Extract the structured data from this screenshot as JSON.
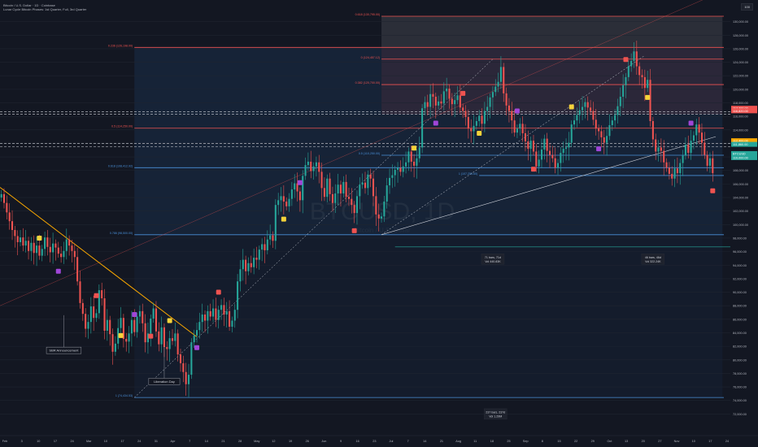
{
  "header": {
    "title": "Bitcoin / U.S. Dollar · 1D · Coinbase",
    "subtitle": "Lunar Cycle Bitcoin Phases: 1st Quarter, Full, 3rd Quarter",
    "scale_button": "100"
  },
  "watermark": {
    "symbol": "BTCUSD, 1D",
    "name": "Bitcoin / U.S. Dollar"
  },
  "colors": {
    "background": "#131722",
    "up": "#26a69a",
    "down": "#ef5350",
    "fib": "#4a90d9",
    "trendline": "#f7a600",
    "badge_yellow": "#f5d33a",
    "badge_purple": "#a046d8",
    "badge_red": "#ef5350"
  },
  "chart_data": {
    "type": "candlestick",
    "symbol": "BTCUSD",
    "timeframe": "1D",
    "ylim": [
      70000,
      132000
    ],
    "y_ticks": [
      "130,000.00",
      "128,000.00",
      "126,000.00",
      "124,000.00",
      "122,000.00",
      "120,000.00",
      "118,000.00",
      "116,000.00",
      "114,000.00",
      "112,000.00",
      "110,000.00",
      "108,000.00",
      "106,000.00",
      "104,000.00",
      "102,000.00",
      "100,000.00",
      "98,000.00",
      "96,000.00",
      "94,000.00",
      "92,000.00",
      "90,000.00",
      "88,000.00",
      "86,000.00",
      "84,000.00",
      "82,000.00",
      "80,000.00",
      "78,000.00",
      "76,000.00",
      "74,000.00",
      "72,000.00"
    ],
    "x_ticks": [
      "Feb",
      "3",
      "10",
      "17",
      "24",
      "Mar",
      "10",
      "17",
      "24",
      "31",
      "Apr",
      "7",
      "14",
      "21",
      "28",
      "May",
      "12",
      "19",
      "26",
      "Jun",
      "9",
      "16",
      "23",
      "Jul",
      "7",
      "14",
      "21",
      "Aug",
      "11",
      "18",
      "25",
      "Sep",
      "8",
      "15",
      "22",
      "29",
      "Oct",
      "13",
      "20",
      "27",
      "Nov",
      "10",
      "17",
      "24"
    ],
    "fib_levels": [
      {
        "label": "1 (74,434.53)",
        "value": 74434
      },
      {
        "label": "0.786 (98,500.00)",
        "value": 98500
      },
      {
        "label": "0.618 (108,412.92)",
        "value": 108413
      },
      {
        "label": "0.5 (114,250.00)",
        "value": 114250
      },
      {
        "label": "0 (124,457.12)",
        "value": 124457
      },
      {
        "label": "0.236 (126,198.00)",
        "value": 126198
      },
      {
        "label": "0.618 (130,795.00)",
        "value": 130795
      },
      {
        "label": "0.382 (120,700.00)",
        "value": 120700
      },
      {
        "label": "0.5 (110,250.00)",
        "value": 110250
      },
      {
        "label": "1 (107,255.60)",
        "value": 107256
      }
    ],
    "dashed_levels": [
      116700,
      116300,
      112000,
      111500
    ],
    "price_tags": [
      {
        "label": "117,200.00",
        "value": 117200,
        "color": "#ef5350"
      },
      {
        "label": "116,820.00",
        "value": 116820,
        "color": "#ef5350"
      },
      {
        "label": "112,400.00",
        "value": 112400,
        "color": "#f7a600"
      },
      {
        "label": "111,860.00",
        "value": 111860,
        "color": "#26a69a"
      },
      {
        "label": "BTCUSD",
        "value": 110500,
        "color": "#26a69a"
      },
      {
        "label": "110,000.00",
        "value": 109900,
        "color": "#26a69a"
      }
    ],
    "annotations": [
      {
        "text": "SBR Announcement"
      },
      {
        "text": "Liberation Day"
      }
    ],
    "measures": [
      {
        "lines": [
          "71 bars, 71d",
          "Vol 440.83K"
        ]
      },
      {
        "lines": [
          "46 bars, 46d",
          "Vol 322.24K"
        ]
      },
      {
        "lines": [
          "237 bars, 237d",
          "Vol 1.29M"
        ]
      }
    ],
    "closes": [
      104500,
      103200,
      101800,
      100500,
      99200,
      98300,
      97400,
      98100,
      96900,
      97600,
      96100,
      97300,
      95800,
      96900,
      95400,
      96400,
      98100,
      96700,
      95900,
      97200,
      96600,
      95700,
      95200,
      96100,
      97800,
      96900,
      96100,
      95200,
      91600,
      88400,
      86800,
      84600,
      85600,
      87900,
      86200,
      86900,
      90300,
      89100,
      84300,
      85900,
      83800,
      81200,
      82400,
      84700,
      86200,
      83100,
      82700,
      83900,
      85900,
      84100,
      86400,
      87200,
      85400,
      82600,
      83900,
      86100,
      87600,
      84200,
      82300,
      84800,
      81900,
      81600,
      83200,
      82800,
      83900,
      80800,
      79500,
      78200,
      76400,
      77800,
      82600,
      83600,
      84400,
      85600,
      86700,
      85800,
      87200,
      86400,
      87600,
      85900,
      87400,
      88100,
      86700,
      87200,
      84900,
      85800,
      87400,
      91600,
      93400,
      94800,
      93100,
      94300,
      93700,
      95100,
      94800,
      96300,
      97100,
      96200,
      97800,
      98400,
      97600,
      102900,
      103600,
      104200,
      103400,
      102700,
      103800,
      105200,
      106100,
      104900,
      103600,
      107200,
      108800,
      109300,
      107900,
      108600,
      109200,
      107800,
      105400,
      104100,
      106800,
      104500,
      103200,
      104600,
      105900,
      104600,
      106300,
      104100,
      103800,
      102900,
      101700,
      104200,
      105900,
      106200,
      105400,
      107400,
      106800,
      104200,
      101500,
      100900,
      101200,
      103400,
      105800,
      106900,
      107300,
      108100,
      108400,
      107800,
      108600,
      109200,
      110800,
      109300,
      108700,
      109800,
      111400,
      117200,
      118100,
      117400,
      119300,
      118900,
      117600,
      118200,
      117900,
      119700,
      120100,
      118600,
      117800,
      118400,
      119100,
      117300,
      116800,
      115900,
      114200,
      113800,
      114600,
      115300,
      116100,
      114900,
      116800,
      117400,
      118800,
      119600,
      120400,
      121100,
      123300,
      119400,
      117600,
      116800,
      115400,
      113600,
      114200,
      114900,
      113500,
      112300,
      111200,
      112400,
      110800,
      108600,
      109600,
      111100,
      112700,
      110900,
      110300,
      109800,
      108400,
      109100,
      110600,
      111200,
      111400,
      112100,
      114800,
      115400,
      116200,
      116900,
      117400,
      118100,
      117300,
      116800,
      115500,
      114200,
      113800,
      112900,
      112100,
      113100,
      114700,
      115400,
      116200,
      117500,
      118900,
      120600,
      121800,
      123400,
      124200,
      125600,
      123400,
      122100,
      121800,
      120200,
      121400,
      115300,
      112600,
      110800,
      111400,
      110900,
      109200,
      108400,
      107500,
      106800,
      108300,
      107600,
      109100,
      110200,
      111800,
      110600,
      112400,
      113200,
      114800,
      113600,
      112100,
      110300,
      108700,
      109800,
      107600
    ]
  }
}
